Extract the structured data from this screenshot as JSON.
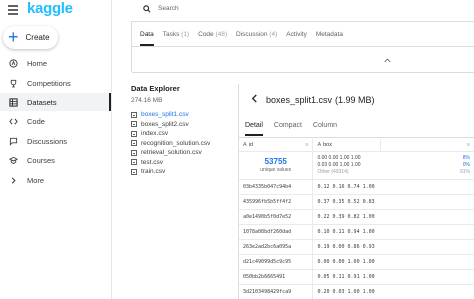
{
  "app": {
    "logo": "kaggle"
  },
  "sidebar": {
    "create_label": "Create",
    "items": [
      {
        "label": "Home",
        "icon": "home-icon"
      },
      {
        "label": "Competitions",
        "icon": "trophy-icon"
      },
      {
        "label": "Datasets",
        "icon": "table-icon",
        "active": true
      },
      {
        "label": "Code",
        "icon": "code-icon"
      },
      {
        "label": "Discussions",
        "icon": "comments-icon"
      },
      {
        "label": "Courses",
        "icon": "school-icon"
      },
      {
        "label": "More",
        "icon": "expand-icon"
      }
    ]
  },
  "search": {
    "placeholder": "Search"
  },
  "tabs": [
    {
      "label": "Data",
      "count": "",
      "active": true
    },
    {
      "label": "Tasks",
      "count": "(1)"
    },
    {
      "label": "Code",
      "count": "(48)"
    },
    {
      "label": "Discussion",
      "count": "(4)"
    },
    {
      "label": "Activity",
      "count": ""
    },
    {
      "label": "Metadata",
      "count": ""
    }
  ],
  "explorer": {
    "title": "Data Explorer",
    "size": "274.16 MB",
    "files": [
      {
        "name": "boxes_split1.csv",
        "active": true
      },
      {
        "name": "boxes_split2.csv"
      },
      {
        "name": "index.csv"
      },
      {
        "name": "recognition_solution.csv"
      },
      {
        "name": "retrieval_solution.csv"
      },
      {
        "name": "test.csv"
      },
      {
        "name": "train.csv"
      }
    ]
  },
  "detail": {
    "file_name": "boxes_split1.csv",
    "file_size": "(1.99 MB)",
    "subtabs": [
      "Detail",
      "Compact",
      "Column"
    ],
    "columns": [
      {
        "name": "id",
        "icon": "A"
      },
      {
        "name": "box",
        "icon": "A"
      }
    ],
    "stats": {
      "unique_count": "53755",
      "unique_label": "unique values",
      "box_values": [
        {
          "value": "0.00 0.00 1.00 1.00",
          "pct": "8%"
        },
        {
          "value": "0.03 0.00 1.00 1.00",
          "pct": "0%"
        },
        {
          "value": "Other (49314)",
          "pct": "91%",
          "other": true
        }
      ]
    },
    "rows": [
      {
        "id": "03b4335b047c94b4",
        "box": "0.12 0.16 0.74 1.00"
      },
      {
        "id": "435996fb5b5ff4f2",
        "box": "0.37 0.35 0.52 0.83"
      },
      {
        "id": "a0e1490b5f0d7e52",
        "box": "0.22 0.39 0.82 1.00"
      },
      {
        "id": "1078a08bdf260dad",
        "box": "0.10 0.11 0.94 1.00"
      },
      {
        "id": "263e2ad2bc6a095a",
        "box": "0.19 0.00 0.86 0.93"
      },
      {
        "id": "d21c49099d5c9c95",
        "box": "0.00 0.00 1.00 1.00"
      },
      {
        "id": "050bb2b6665491",
        "box": "0.05 0.11 0.91 1.00"
      },
      {
        "id": "3d2103498429fca9",
        "box": "0.20 0.03 1.00 1.00"
      }
    ]
  }
}
